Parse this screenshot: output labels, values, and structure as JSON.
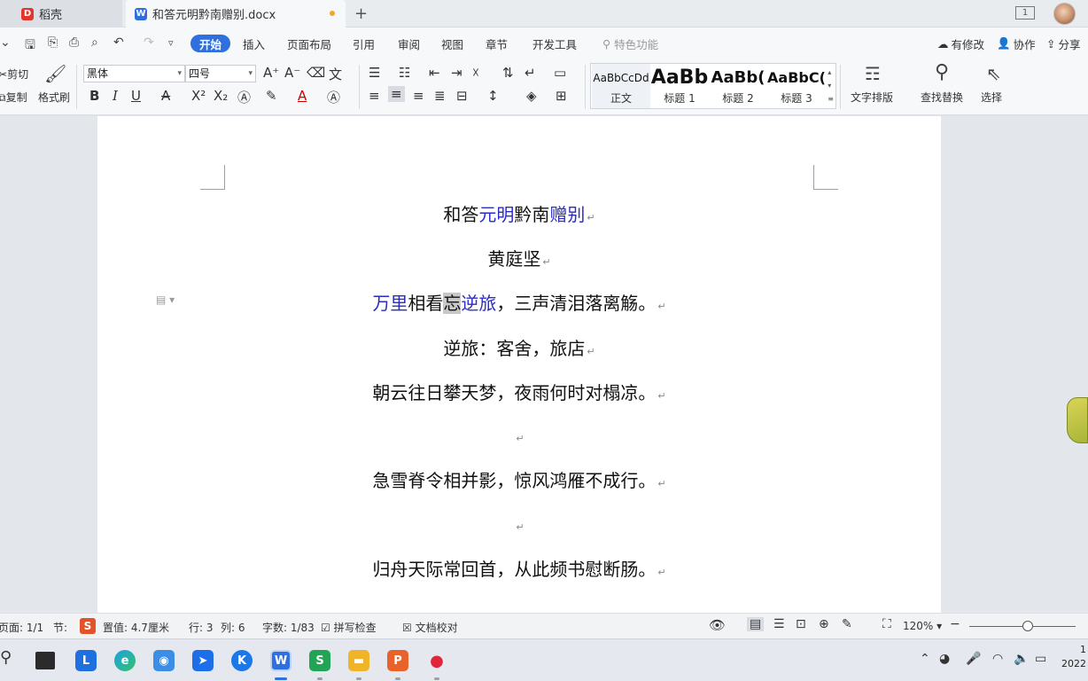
{
  "tabs": {
    "home_label": "稻壳",
    "doc_label": "和答元明黔南赠别.docx",
    "add_symbol": "+",
    "window_badge": "1"
  },
  "menu": {
    "items": [
      "开始",
      "插入",
      "页面布局",
      "引用",
      "审阅",
      "视图",
      "章节",
      "开发工具"
    ],
    "search_placeholder": "特色功能",
    "has_changes": "有修改",
    "collab": "协作",
    "share": "分享"
  },
  "ribbon": {
    "cut": "剪切",
    "copy": "复制",
    "format_painter": "格式刷",
    "font_name": "黑体",
    "font_size": "四号",
    "styles": [
      {
        "sample": "AaBbCcDd",
        "name": "正文"
      },
      {
        "sample": "AaBb",
        "name": "标题 1"
      },
      {
        "sample": "AaBb(",
        "name": "标题 2"
      },
      {
        "sample": "AaBbC(",
        "name": "标题 3"
      }
    ],
    "text_layout": "文字排版",
    "find_replace": "查找替换",
    "select": "选择"
  },
  "document": {
    "title_plain_1": "和答",
    "title_blue_1": "元明",
    "title_plain_2": "黔南",
    "title_blue_2": "赠别",
    "author": "黄庭坚",
    "line3_blue": "万里",
    "line3_plain": "相看",
    "line3_selected": "忘",
    "line3_blue_2": "逆旅",
    "line3_rest": "，三声清泪落离觞。",
    "line4": "逆旅：客舍，旅店",
    "line5": "朝云往日攀天梦，夜雨何时对榻凉。",
    "line7": "急雪脊令相并影，惊风鸿雁不成行。",
    "line9": "归舟天际常回首，从此频书慰断肠。",
    "para_mark": "↵"
  },
  "status": {
    "page": "页面: 1/1",
    "section": "节:",
    "position": "置值: 4.7厘米",
    "row": "行: 3",
    "col": "列: 6",
    "word_count": "字数: 1/83",
    "spell_check": "拼写检查",
    "doc_proof": "文档校对",
    "zoom": "120%",
    "zoom_level": 0.55
  },
  "taskbar": {
    "clock_line1": "1",
    "clock_line2": "2022"
  }
}
